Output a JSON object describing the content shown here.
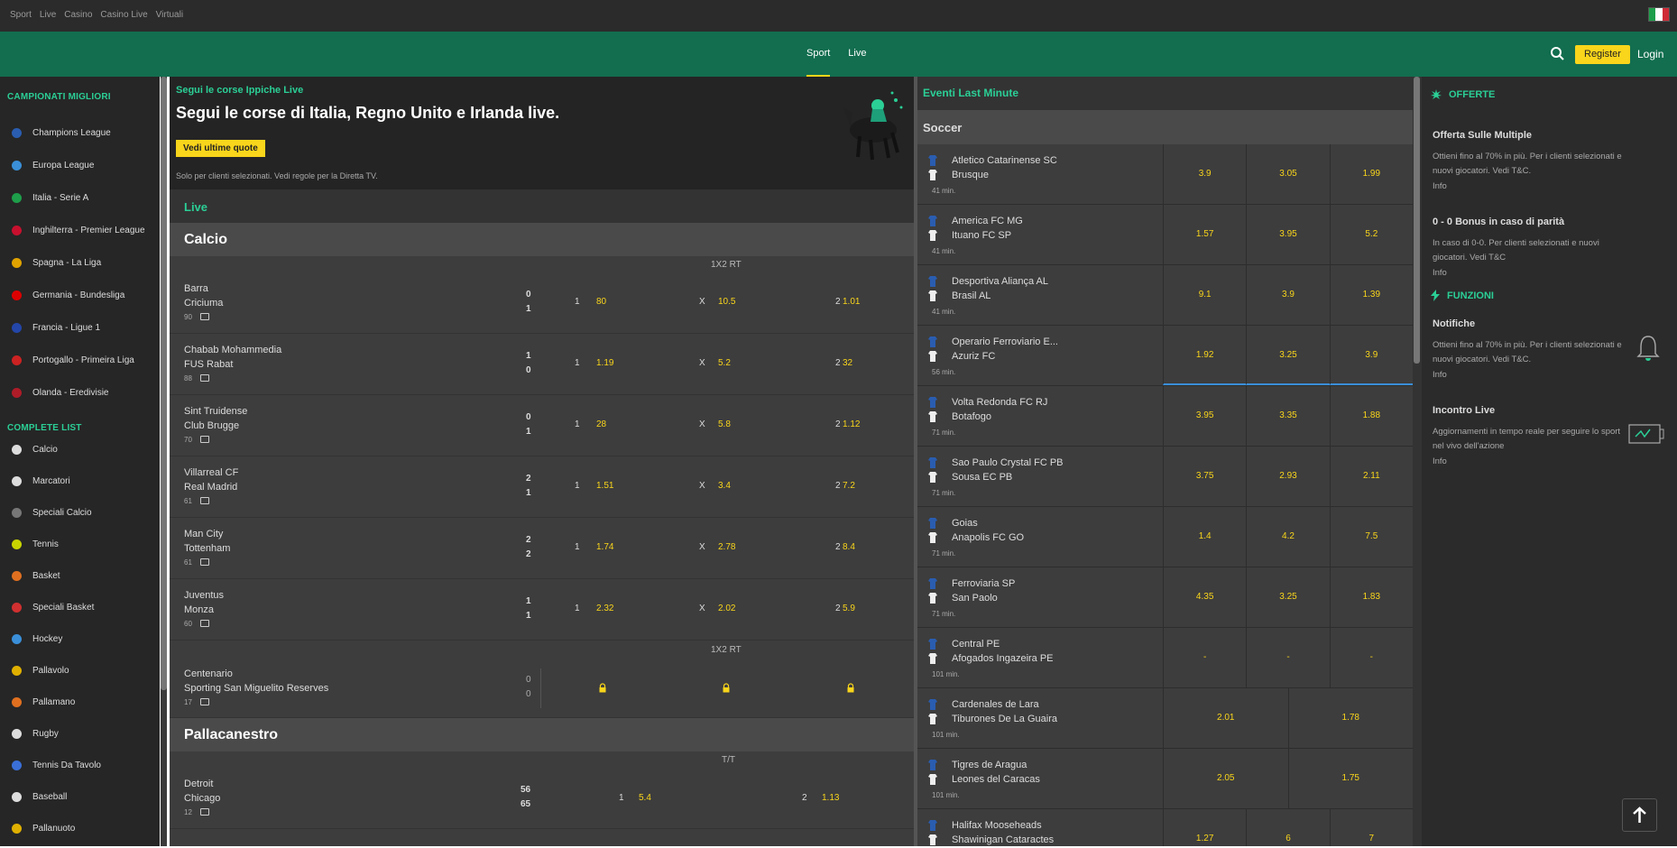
{
  "topnav": [
    "Sport",
    "Live",
    "Casino",
    "Casino Live",
    "Virtuali"
  ],
  "header": {
    "tabs": [
      "Sport",
      "Live"
    ],
    "register": "Register",
    "login": "Login"
  },
  "sidebar": {
    "top_title": "CAMPIONATI MIGLIORI",
    "top": [
      {
        "label": "Champions League",
        "color": "#2a5db0"
      },
      {
        "label": "Europa League",
        "color": "#3a8fd8"
      },
      {
        "label": "Italia - Serie A",
        "color": "#1e9e4a"
      },
      {
        "label": "Inghilterra - Premier League",
        "color": "#c8102e"
      },
      {
        "label": "Spagna - La Liga",
        "color": "#e0a300"
      },
      {
        "label": "Germania - Bundesliga",
        "color": "#dd0000"
      },
      {
        "label": "Francia - Ligue 1",
        "color": "#2346a8"
      },
      {
        "label": "Portogallo - Primeira Liga",
        "color": "#cc2222"
      },
      {
        "label": "Olanda - Eredivisie",
        "color": "#ae1c28"
      }
    ],
    "list_title": "COMPLETE LIST",
    "list": [
      {
        "label": "Calcio",
        "color": "#dddddd"
      },
      {
        "label": "Marcatori",
        "color": "#dddddd"
      },
      {
        "label": "Speciali Calcio",
        "color": "#777777"
      },
      {
        "label": "Tennis",
        "color": "#c8d400"
      },
      {
        "label": "Basket",
        "color": "#e07020"
      },
      {
        "label": "Speciali Basket",
        "color": "#d03030"
      },
      {
        "label": "Hockey",
        "color": "#3a8fd8"
      },
      {
        "label": "Pallavolo",
        "color": "#e0b000"
      },
      {
        "label": "Pallamano",
        "color": "#e07020"
      },
      {
        "label": "Rugby",
        "color": "#dddddd"
      },
      {
        "label": "Tennis Da Tavolo",
        "color": "#3a6fd8"
      },
      {
        "label": "Baseball",
        "color": "#dddddd"
      },
      {
        "label": "Pallanuoto",
        "color": "#e0b000"
      }
    ]
  },
  "banner": {
    "kicker": "Segui le corse Ippiche Live",
    "title": "Segui le corse di Italia, Regno Unito e Irlanda live.",
    "button": "Vedi ultime quote",
    "note": "Solo per clienti selezionati. Vedi regole per la Diretta TV."
  },
  "live_label": "Live",
  "calcio": {
    "title": "Calcio",
    "market": "1X2 RT",
    "events": [
      {
        "t1": "Barra",
        "t2": "Criciuma",
        "min": "90",
        "s1": "0",
        "s2": "1",
        "o1": "80",
        "ox": "10.5",
        "o2": "1.01"
      },
      {
        "t1": "Chabab Mohammedia",
        "t2": "FUS Rabat",
        "min": "88",
        "s1": "1",
        "s2": "0",
        "o1": "1.19",
        "ox": "5.2",
        "o2": "32"
      },
      {
        "t1": "Sint Truidense",
        "t2": "Club Brugge",
        "min": "70",
        "s1": "0",
        "s2": "1",
        "o1": "28",
        "ox": "5.8",
        "o2": "1.12"
      },
      {
        "t1": "Villarreal CF",
        "t2": "Real Madrid",
        "min": "61",
        "s1": "2",
        "s2": "1",
        "o1": "1.51",
        "ox": "3.4",
        "o2": "7.2"
      },
      {
        "t1": "Man City",
        "t2": "Tottenham",
        "min": "61",
        "s1": "2",
        "s2": "2",
        "o1": "1.74",
        "ox": "2.78",
        "o2": "8.4"
      },
      {
        "t1": "Juventus",
        "t2": "Monza",
        "min": "60",
        "s1": "1",
        "s2": "1",
        "o1": "2.32",
        "ox": "2.02",
        "o2": "5.9"
      }
    ],
    "market2": "1X2 RT",
    "locked": {
      "t1": "Centenario",
      "t2": "Sporting San Miguelito Reserves",
      "min": "17",
      "s1": "0",
      "s2": "0"
    }
  },
  "basket": {
    "title": "Pallacanestro",
    "market": "T/T",
    "event": {
      "t1": "Detroit",
      "t2": "Chicago",
      "min": "12",
      "s1": "56",
      "s2": "65",
      "o1": "5.4",
      "o2": "1.13"
    }
  },
  "outcome_labels": {
    "home": "1",
    "draw": "X",
    "away": "2"
  },
  "lastminute": {
    "title": "Eventi Last Minute",
    "sport": "Soccer",
    "events": [
      {
        "t1": "Atletico Catarinense SC",
        "t2": "Brusque",
        "min": "41 min.",
        "odds": [
          "3.9",
          "3.05",
          "1.99"
        ]
      },
      {
        "t1": "America FC MG",
        "t2": "Ituano FC SP",
        "min": "41 min.",
        "odds": [
          "1.57",
          "3.95",
          "5.2"
        ]
      },
      {
        "t1": "Desportiva Aliança AL",
        "t2": "Brasil AL",
        "min": "41 min.",
        "odds": [
          "9.1",
          "3.9",
          "1.39"
        ]
      },
      {
        "t1": "Operario Ferroviario E...",
        "t2": "Azuriz FC",
        "min": "56 min.",
        "odds": [
          "1.92",
          "3.25",
          "3.9"
        ]
      },
      {
        "t1": "Volta Redonda FC RJ",
        "t2": "Botafogo",
        "min": "71 min.",
        "odds": [
          "3.95",
          "3.35",
          "1.88"
        ]
      },
      {
        "t1": "Sao Paulo Crystal FC PB",
        "t2": "Sousa EC PB",
        "min": "71 min.",
        "odds": [
          "3.75",
          "2.93",
          "2.11"
        ]
      },
      {
        "t1": "Goias",
        "t2": "Anapolis FC GO",
        "min": "71 min.",
        "odds": [
          "1.4",
          "4.2",
          "7.5"
        ]
      },
      {
        "t1": "Ferroviaria SP",
        "t2": "San Paolo",
        "min": "71 min.",
        "odds": [
          "4.35",
          "3.25",
          "1.83"
        ]
      },
      {
        "t1": "Central PE",
        "t2": "Afogados Ingazeira PE",
        "min": "101 min.",
        "odds": [
          "-",
          "-",
          "-"
        ]
      },
      {
        "t1": "Cardenales de Lara",
        "t2": "Tiburones De La Guaira",
        "min": "101 min.",
        "odds": [
          "2.01",
          "1.78"
        ]
      },
      {
        "t1": "Tigres de Aragua",
        "t2": "Leones del Caracas",
        "min": "101 min.",
        "odds": [
          "2.05",
          "1.75"
        ]
      },
      {
        "t1": "Halifax Mooseheads",
        "t2": "Shawinigan Cataractes",
        "min": "",
        "odds": [
          "1.27",
          "6",
          "7"
        ]
      }
    ]
  },
  "offers": {
    "title": "OFFERTE",
    "items": [
      {
        "title": "Offerta Sulle Multiple",
        "desc": "Ottieni fino al 70% in più. Per i clienti selezionati e nuovi giocatori. Vedi T&C.",
        "info": "Info"
      },
      {
        "title": "0 - 0 Bonus in caso di parità",
        "desc": "In caso di 0-0. Per clienti selezionati e nuovi giocatori. Vedi T&C",
        "info": "Info"
      }
    ]
  },
  "functions": {
    "title": "FUNZIONI",
    "items": [
      {
        "title": "Notifiche",
        "desc": "Ottieni fino al 70% in più. Per i clienti selezionati e nuovi giocatori. Vedi T&C.",
        "info": "Info"
      },
      {
        "title": "Incontro Live",
        "desc": "Aggiornamenti in tempo reale per seguire lo sport nel vivo dell'azione",
        "info": "Info"
      }
    ]
  },
  "colors": {
    "accent": "#2bcf96",
    "brand_green": "#126e4f",
    "odds": "#f9d51b"
  }
}
